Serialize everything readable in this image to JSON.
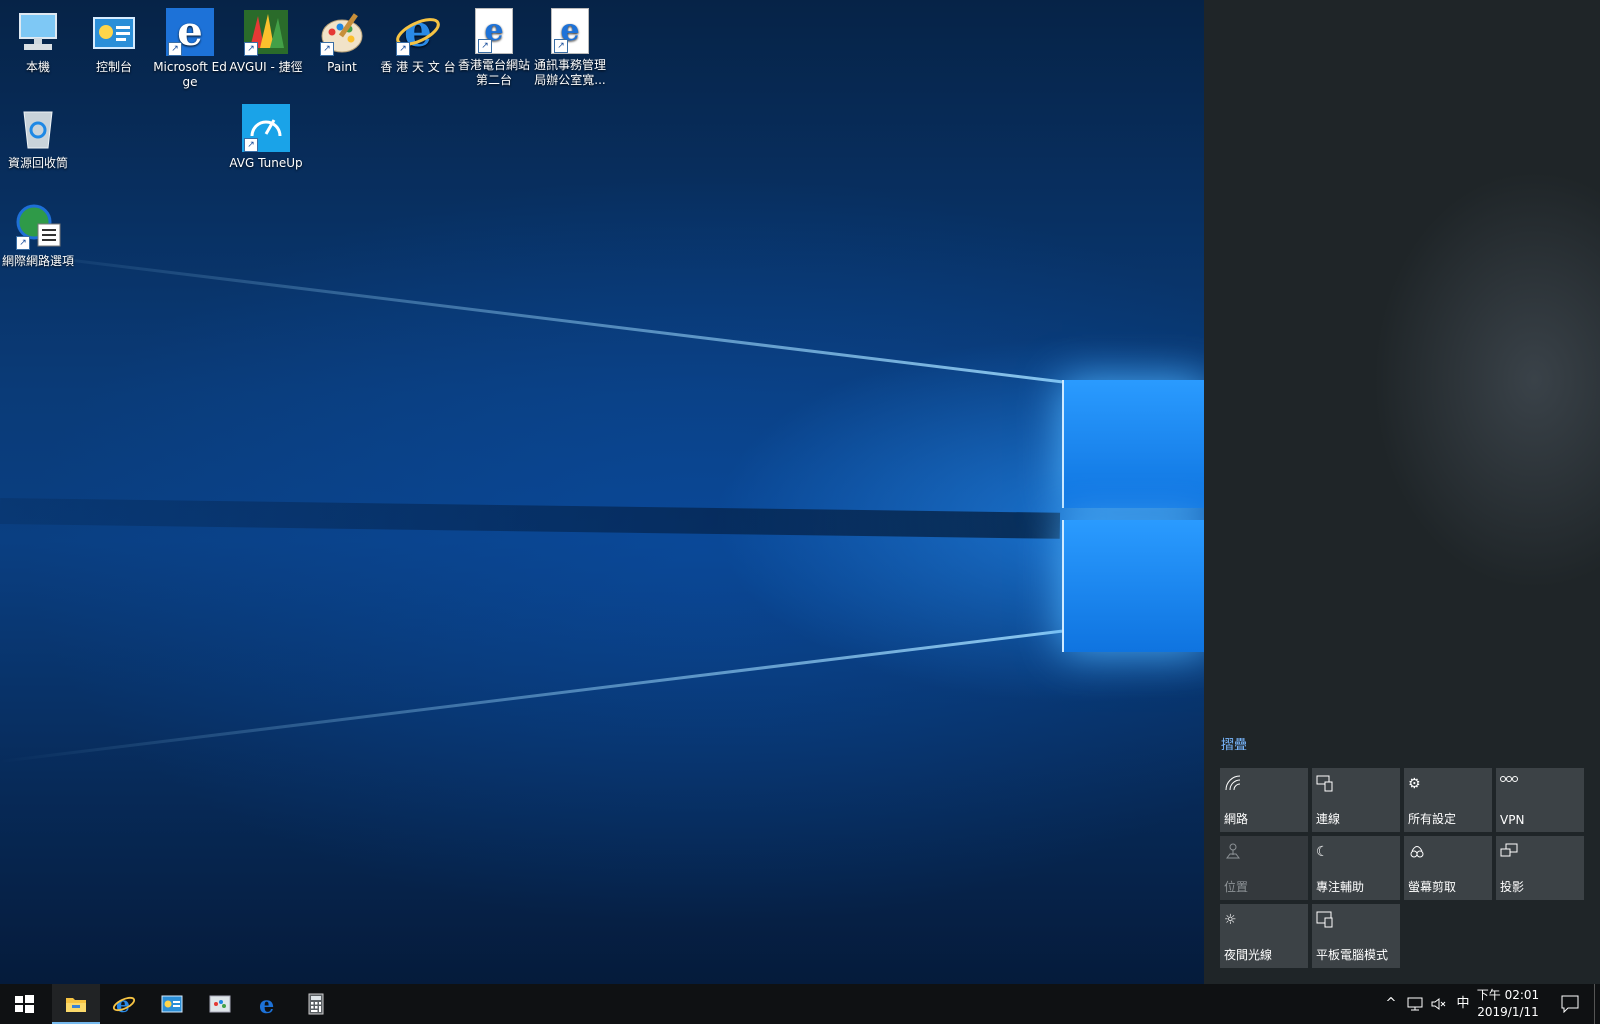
{
  "desktop": {
    "icons": [
      {
        "label": "本機",
        "icon": "this-pc-icon"
      },
      {
        "label": "控制台",
        "icon": "control-panel-icon"
      },
      {
        "label": "Microsoft Edge",
        "icon": "edge-icon"
      },
      {
        "label": "AVGUI - 捷徑",
        "icon": "avg-icon"
      },
      {
        "label": "Paint",
        "icon": "paint-icon"
      },
      {
        "label": "香 港 天 文 台",
        "icon": "ie-icon"
      },
      {
        "label": "香港電台網站第二台",
        "icon": "edge-doc-icon"
      },
      {
        "label": "通訊事務管理局辦公室寬...",
        "icon": "edge-doc-icon"
      },
      {
        "label": "資源回收筒",
        "icon": "recycle-bin-icon"
      },
      {
        "label": "AVG TuneUp",
        "icon": "avg-tuneup-icon"
      },
      {
        "label": "網際網路選項",
        "icon": "internet-options-icon"
      }
    ]
  },
  "action_center": {
    "collapse_label": "摺疊",
    "tiles": [
      {
        "label": "網路",
        "icon": "network-icon",
        "enabled": true
      },
      {
        "label": "連線",
        "icon": "connect-icon",
        "enabled": true
      },
      {
        "label": "所有設定",
        "icon": "settings-gear-icon",
        "enabled": true
      },
      {
        "label": "VPN",
        "icon": "vpn-icon",
        "enabled": true
      },
      {
        "label": "位置",
        "icon": "location-icon",
        "enabled": false
      },
      {
        "label": "專注輔助",
        "icon": "moon-icon",
        "enabled": true
      },
      {
        "label": "螢幕剪取",
        "icon": "snip-icon",
        "enabled": true
      },
      {
        "label": "投影",
        "icon": "project-icon",
        "enabled": true
      },
      {
        "label": "夜間光線",
        "icon": "brightness-icon",
        "enabled": true
      },
      {
        "label": "平板電腦模式",
        "icon": "tablet-mode-icon",
        "enabled": true
      }
    ]
  },
  "taskbar": {
    "pinned": [
      "start-icon",
      "file-explorer-icon",
      "internet-explorer-icon",
      "control-panel-icon",
      "paint-icon",
      "edge-icon",
      "calculator-icon"
    ],
    "tray": {
      "chevron": "^",
      "ime": "中",
      "time": "下午 02:01",
      "date": "2019/1/11"
    }
  },
  "colors": {
    "taskbar": "#0f1113",
    "action_center": "#1f2528",
    "tile": "#3c4246",
    "accent": "#79b8ff"
  }
}
